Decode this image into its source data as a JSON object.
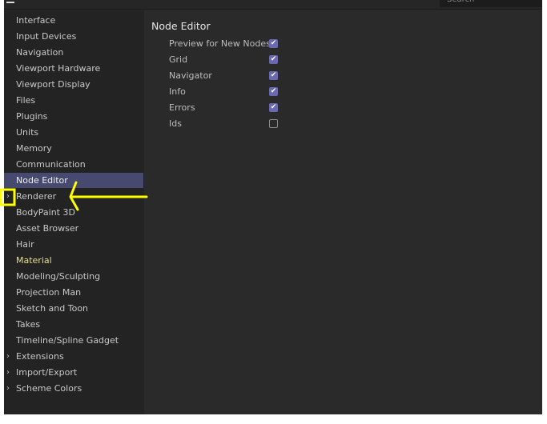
{
  "search": {
    "placeholder": "Search"
  },
  "sidebar": {
    "items": [
      {
        "label": "Interface"
      },
      {
        "label": "Input Devices"
      },
      {
        "label": "Navigation"
      },
      {
        "label": "Viewport Hardware"
      },
      {
        "label": "Viewport Display"
      },
      {
        "label": "Files"
      },
      {
        "label": "Plugins"
      },
      {
        "label": "Units"
      },
      {
        "label": "Memory"
      },
      {
        "label": "Communication"
      },
      {
        "label": "Node Editor",
        "selected": true
      },
      {
        "label": "Renderer",
        "expandable": true
      },
      {
        "label": "BodyPaint 3D"
      },
      {
        "label": "Asset Browser"
      },
      {
        "label": "Hair"
      },
      {
        "label": "Material",
        "highlight": "#e8dc8c"
      },
      {
        "label": "Modeling/Sculpting"
      },
      {
        "label": "Projection Man"
      },
      {
        "label": "Sketch and Toon"
      },
      {
        "label": "Takes"
      },
      {
        "label": "Timeline/Spline Gadget"
      },
      {
        "label": "Extensions",
        "expandable": true
      },
      {
        "label": "Import/Export",
        "expandable": true
      },
      {
        "label": "Scheme Colors",
        "expandable": true
      }
    ]
  },
  "main": {
    "title": "Node Editor",
    "options": [
      {
        "label": "Preview for New Nodes",
        "checked": true
      },
      {
        "label": "Grid",
        "checked": true
      },
      {
        "label": "Navigator",
        "checked": true
      },
      {
        "label": "Info",
        "checked": true
      },
      {
        "label": "Errors",
        "checked": true
      },
      {
        "label": "Ids",
        "checked": false
      }
    ]
  },
  "colors": {
    "selection": "#474a6e",
    "checkbox": "#6a68b0",
    "annotation": "#ffff00"
  }
}
